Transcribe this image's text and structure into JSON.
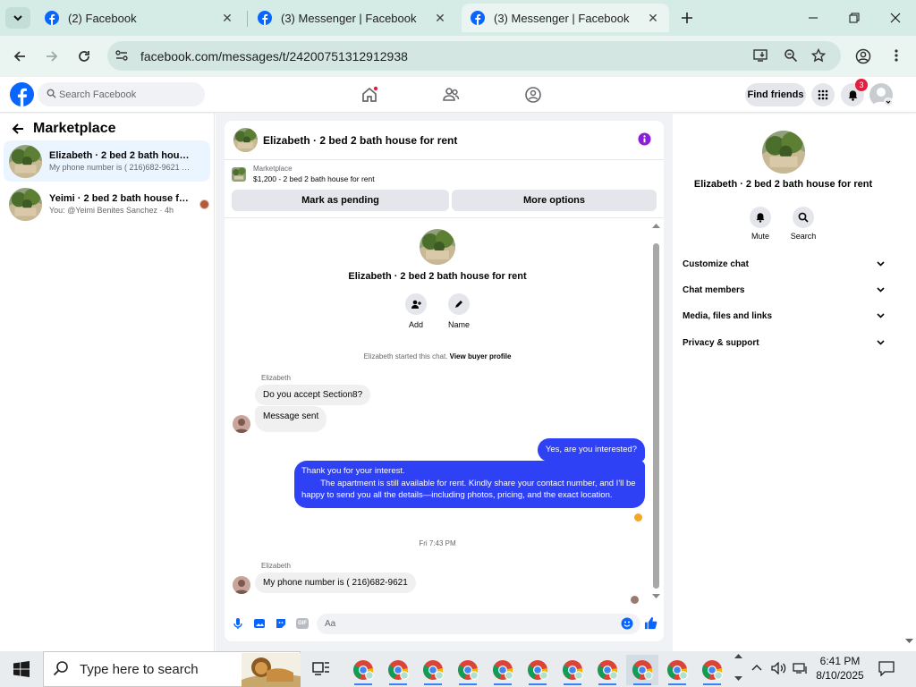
{
  "browser": {
    "tabs": [
      {
        "title": "(2) Facebook",
        "active": false
      },
      {
        "title": "(3) Messenger | Facebook",
        "active": false
      },
      {
        "title": "(3) Messenger | Facebook",
        "active": true
      }
    ],
    "url": "facebook.com/messages/t/24200751312912938",
    "icons": {
      "new_tab": "plus-icon",
      "minimize": "minimize-icon",
      "maximize": "restore-icon",
      "close": "close-icon"
    }
  },
  "fb_header": {
    "search_placeholder": "Search Facebook",
    "find_friends": "Find friends",
    "notification_count": "3",
    "brand_color": "#0866ff"
  },
  "sidebar": {
    "title": "Marketplace",
    "conversations": [
      {
        "name": "Elizabeth · 2 bed 2 bath house for ...",
        "preview": "My phone number is ( 216)682-9621 · 1m",
        "selected": true
      },
      {
        "name": "Yeimi · 2 bed 2 bath house for r...",
        "preview": "You: @Yeimi Benites Sanchez · 4h",
        "selected": false
      }
    ]
  },
  "chat": {
    "title": "Elizabeth · 2 bed 2 bath house for rent",
    "marketplace_label": "Marketplace",
    "listing": "$1,200 - 2 bed 2 bath house for rent",
    "mark_pending": "Mark as pending",
    "more_options": "More options",
    "intro_title": "Elizabeth · 2 bed 2 bath house for rent",
    "intro_actions": [
      {
        "label": "Add",
        "icon": "add-person-icon"
      },
      {
        "label": "Name",
        "icon": "pencil-icon"
      }
    ],
    "started_text": "Elizabeth started this chat.",
    "buyer_profile_link": "View buyer profile",
    "sender_name": "Elizabeth",
    "msg_in_1": "Do you accept Section8?",
    "msg_in_2": "Message sent",
    "msg_out_1": "Yes, are you interested?",
    "msg_out_2": "Thank you for your interest.\n        The apartment is still available for rent. Kindly share your contact number, and I'll be happy to send you all the details—including photos, pricing, and the exact location.",
    "timestamp": "Fri 7:43 PM",
    "sender_name_2": "Elizabeth",
    "msg_in_3": "My phone number is ( 216)682-9621",
    "composer_placeholder": "Aa",
    "accent_color": "#2e41f5"
  },
  "right_panel": {
    "title": "Elizabeth · 2 bed 2 bath house for rent",
    "mute": "Mute",
    "search": "Search",
    "sections": [
      "Customize chat",
      "Chat members",
      "Media, files and links",
      "Privacy & support"
    ]
  },
  "taskbar": {
    "search_placeholder": "Type here to search",
    "time": "6:41 PM",
    "date": "8/10/2025",
    "chrome_windows": 11
  }
}
